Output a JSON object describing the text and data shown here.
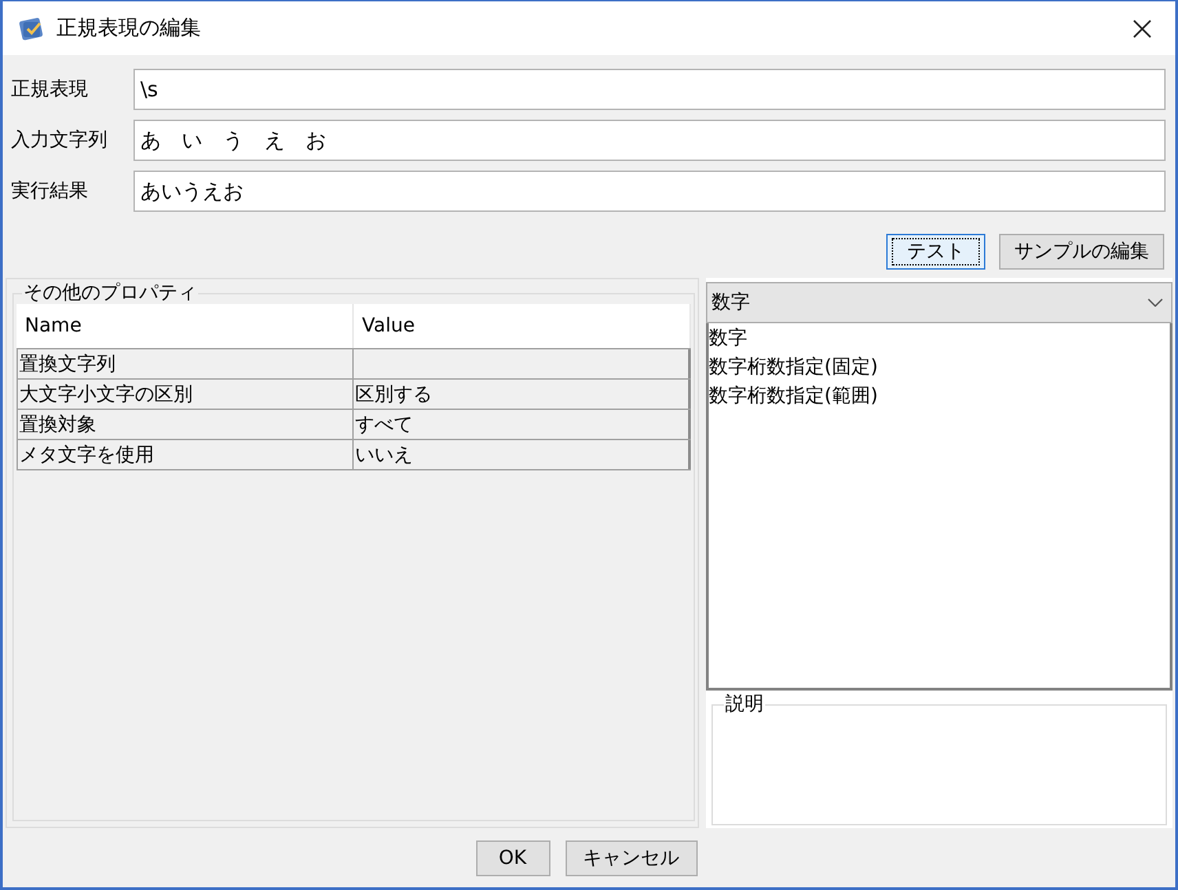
{
  "window": {
    "title": "正規表現の編集"
  },
  "fields": [
    {
      "label": "正規表現",
      "value": "\\s"
    },
    {
      "label": "入力文字列",
      "value": "あ　い　う　え　お"
    },
    {
      "label": "実行結果",
      "value": "あいうえお"
    }
  ],
  "actions": [
    {
      "label": "テスト",
      "focused": true
    },
    {
      "label": "サンプルの編集",
      "focused": false
    }
  ],
  "properties": {
    "title": "その他のプロパティ",
    "columns": [
      "Name",
      "Value"
    ],
    "rows": [
      {
        "name": "置換文字列"
      },
      {
        "name": "大文字小文字の区別",
        "value": "区別する"
      },
      {
        "name": "置換対象",
        "value": "すべて"
      },
      {
        "name": "メタ文字を使用",
        "value": "いいえ"
      }
    ]
  },
  "samples": {
    "category": "数字",
    "items": [
      "数字",
      "数字桁数指定(固定)",
      "数字桁数指定(範囲)"
    ]
  },
  "description": {
    "title": "説明"
  },
  "footer_buttons": [
    "OK",
    "キャンセル"
  ]
}
